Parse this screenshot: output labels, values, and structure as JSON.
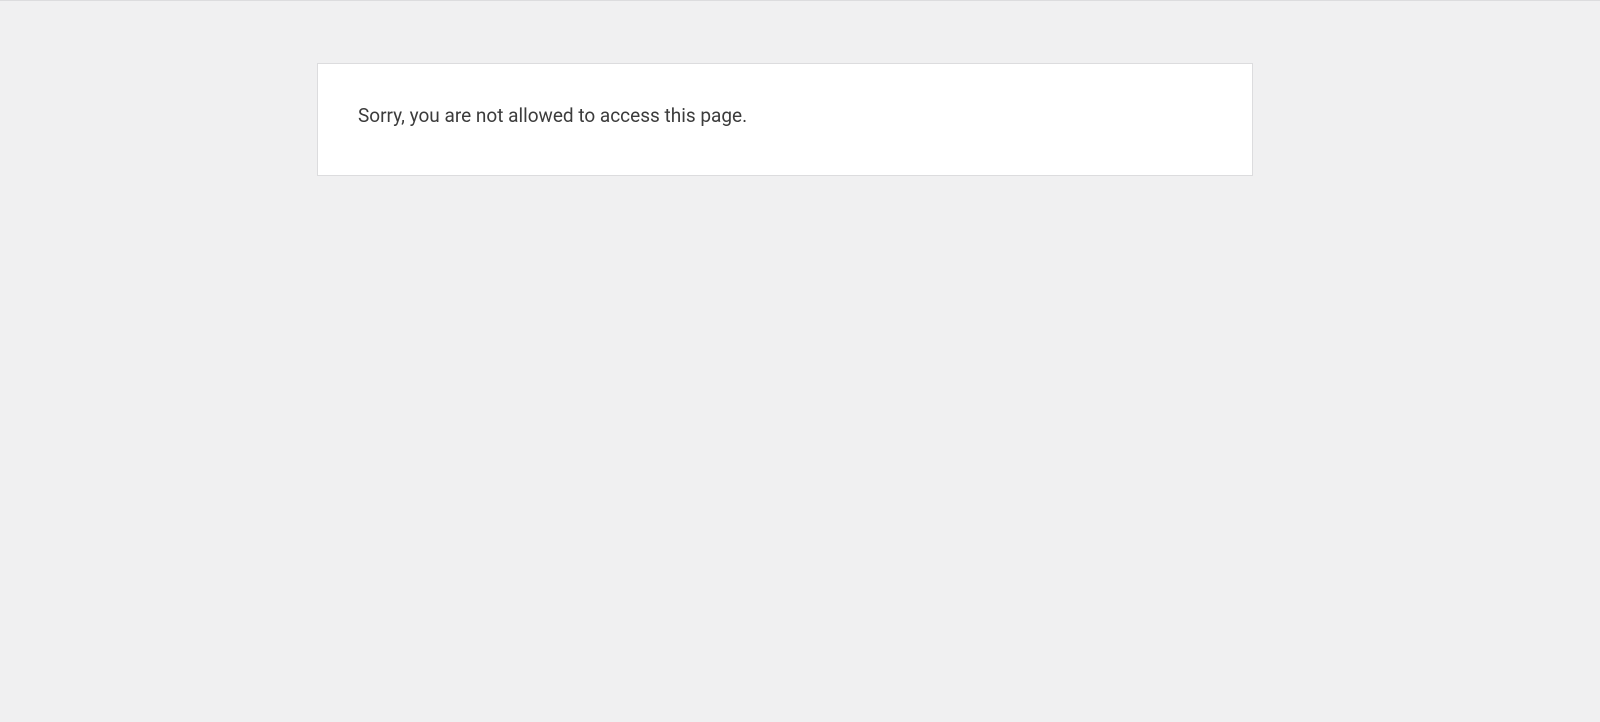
{
  "error": {
    "message": "Sorry, you are not allowed to access this page."
  }
}
